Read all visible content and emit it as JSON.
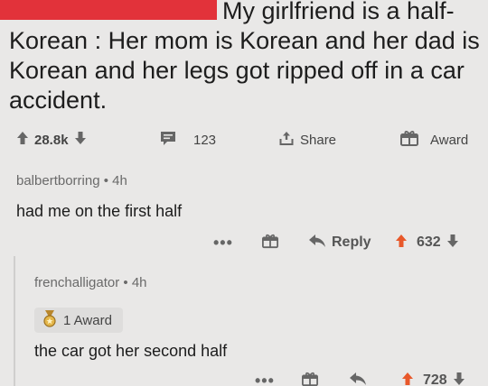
{
  "post": {
    "text_line1": "My girlfriend is a half-",
    "text_rest": "Korean : Her mom is Korean and her dad is Korean and her legs got ripped off in a car accident.",
    "votes": "28.8k",
    "comments": "123",
    "share_label": "Share",
    "award_label": "Award"
  },
  "comment1": {
    "author": "balbertborring",
    "time": "4h",
    "separator": "•",
    "text": "had me on the first half",
    "more": "•••",
    "reply_label": "Reply",
    "votes": "632"
  },
  "comment2": {
    "author": "frenchalligator",
    "time": "4h",
    "separator": "•",
    "award_badge": "1 Award",
    "text": "the car got her second half",
    "more": "•••",
    "votes": "728"
  },
  "colors": {
    "upvote_orange": "#e8582a",
    "redaction_red": "#e2323a"
  }
}
